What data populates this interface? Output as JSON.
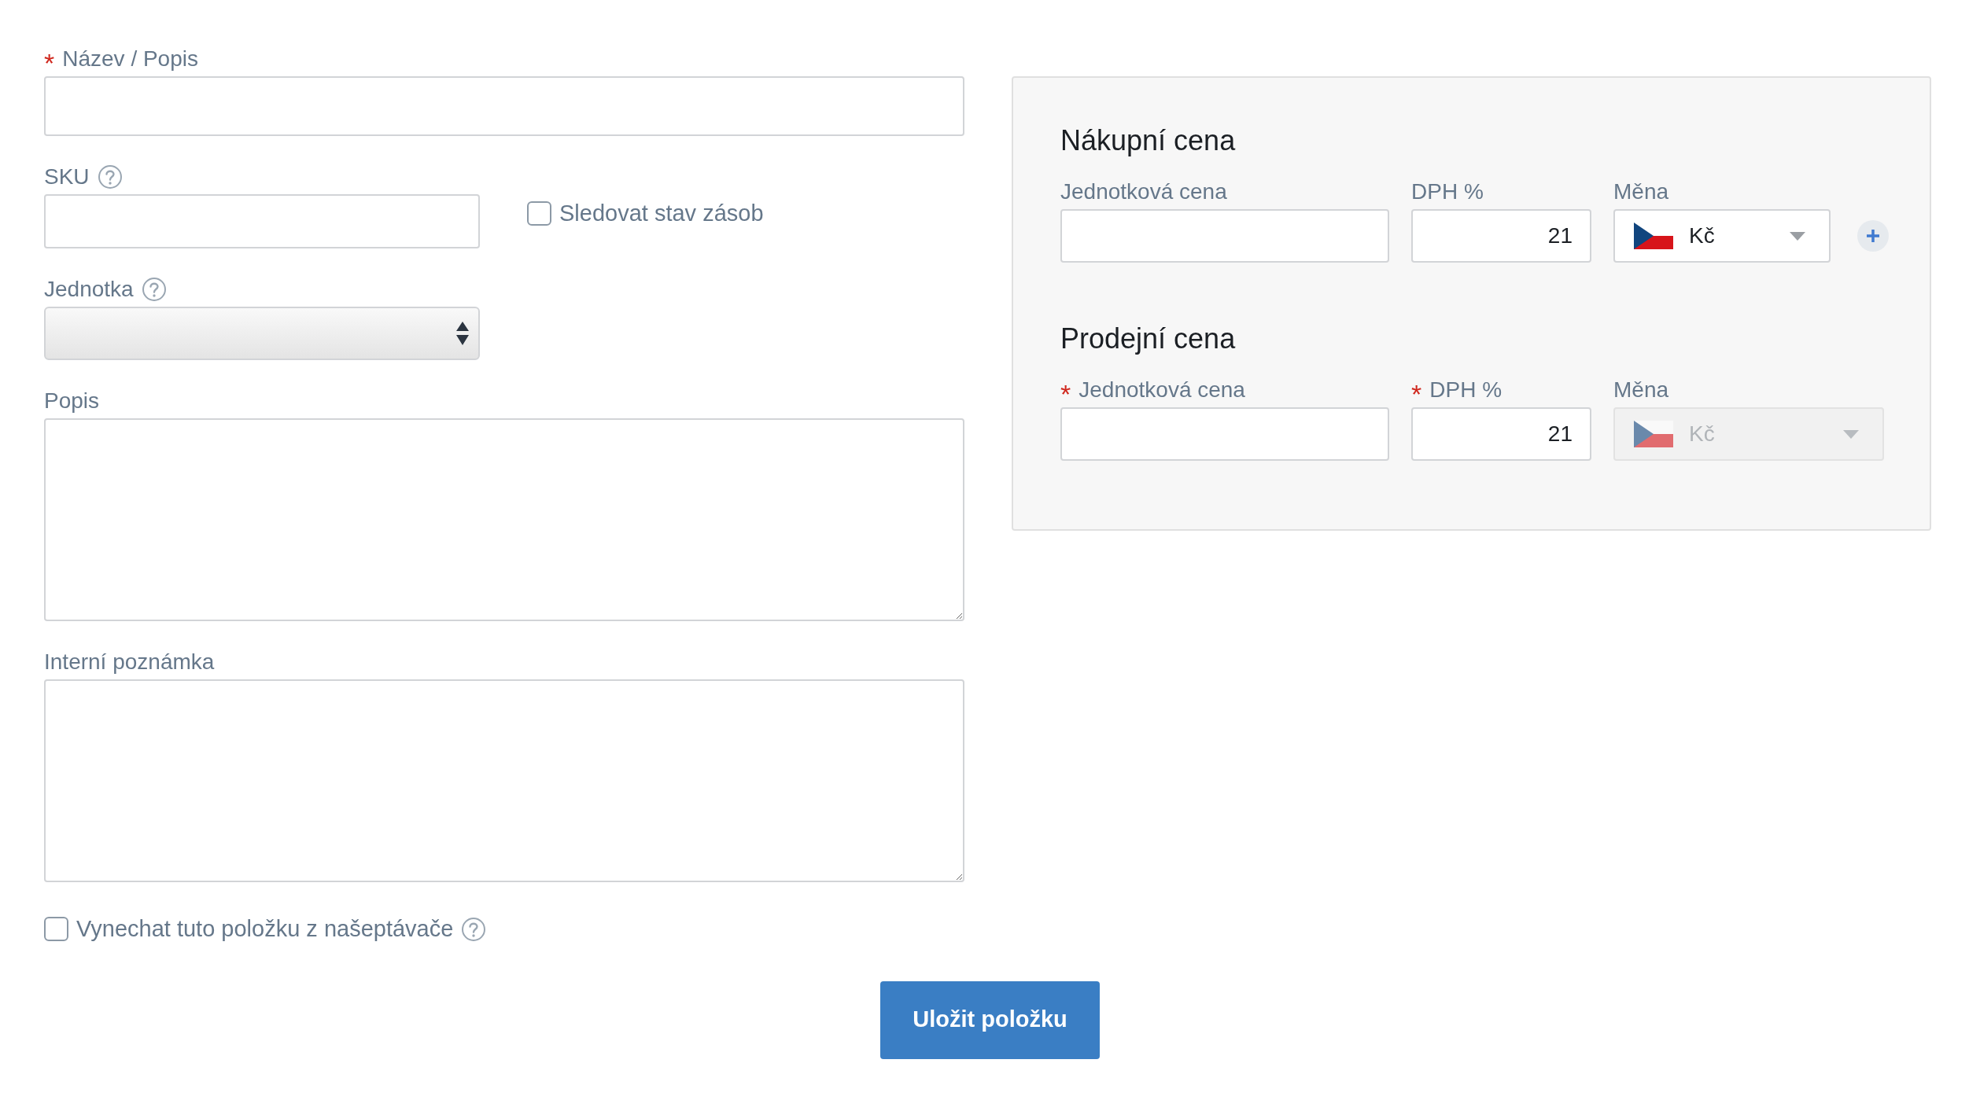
{
  "name_field": {
    "label": "Název / Popis",
    "required_mark": "*"
  },
  "sku_field": {
    "label": "SKU",
    "help": true
  },
  "track_stock": {
    "label": "Sledovat stav zásob",
    "checked": false
  },
  "unit_field": {
    "label": "Jednotka",
    "help": true
  },
  "description_field": {
    "label": "Popis"
  },
  "internal_note_field": {
    "label": "Interní poznámka"
  },
  "exclude_checkbox": {
    "label": "Vynechat tuto položku z našeptávače",
    "checked": false,
    "help": true
  },
  "price_sections": [
    {
      "title": "Nákupní cena",
      "unit_price": {
        "label": "Jednotková cena"
      },
      "vat": {
        "label": "DPH %",
        "value": "21"
      },
      "currency": {
        "label": "Měna",
        "value": "Kč",
        "disabled": false
      },
      "add_button": true
    },
    {
      "title": "Prodejní cena",
      "unit_price": {
        "label": "Jednotková cena",
        "required_mark": "*"
      },
      "vat": {
        "label": "DPH %",
        "required_mark": "*",
        "value": "21"
      },
      "currency": {
        "label": "Měna",
        "value": "Kč",
        "disabled": true
      },
      "add_button": false
    }
  ],
  "save_button": "Uložit položku"
}
